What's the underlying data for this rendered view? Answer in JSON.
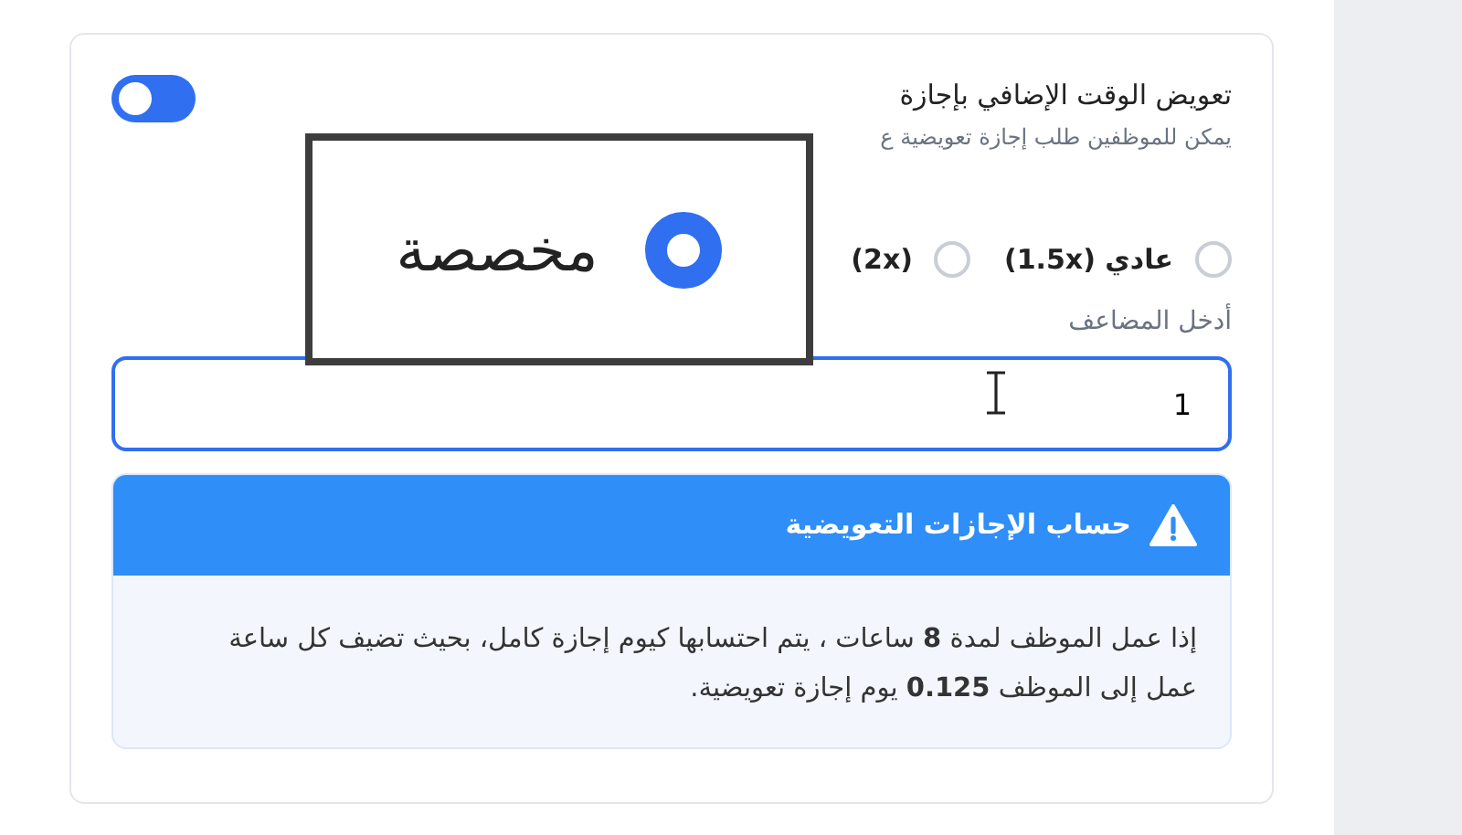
{
  "setting": {
    "title": "تعويض الوقت الإضافي بإجازة",
    "subtitle": "يمكن للموظفين طلب إجازة تعويضية ع",
    "on": true
  },
  "rate_options": [
    {
      "label": "(1.5x) عادي",
      "selected": false
    },
    {
      "label": "(2x)",
      "selected": false
    }
  ],
  "multiplier_field": {
    "label": "أدخل المضاعف",
    "value": "1"
  },
  "info_box": {
    "title": "حساب الإجازات التعويضية",
    "text": "إذا عمل الموظف لمدة **8** ساعات ، يتم احتسابها كيوم إجازة كامل، بحيث تضيف كل ساعة عمل إلى الموظف **0.125** يوم إجازة تعويضية."
  },
  "zoom_callout": {
    "label": "مخصصة",
    "selected": true
  }
}
